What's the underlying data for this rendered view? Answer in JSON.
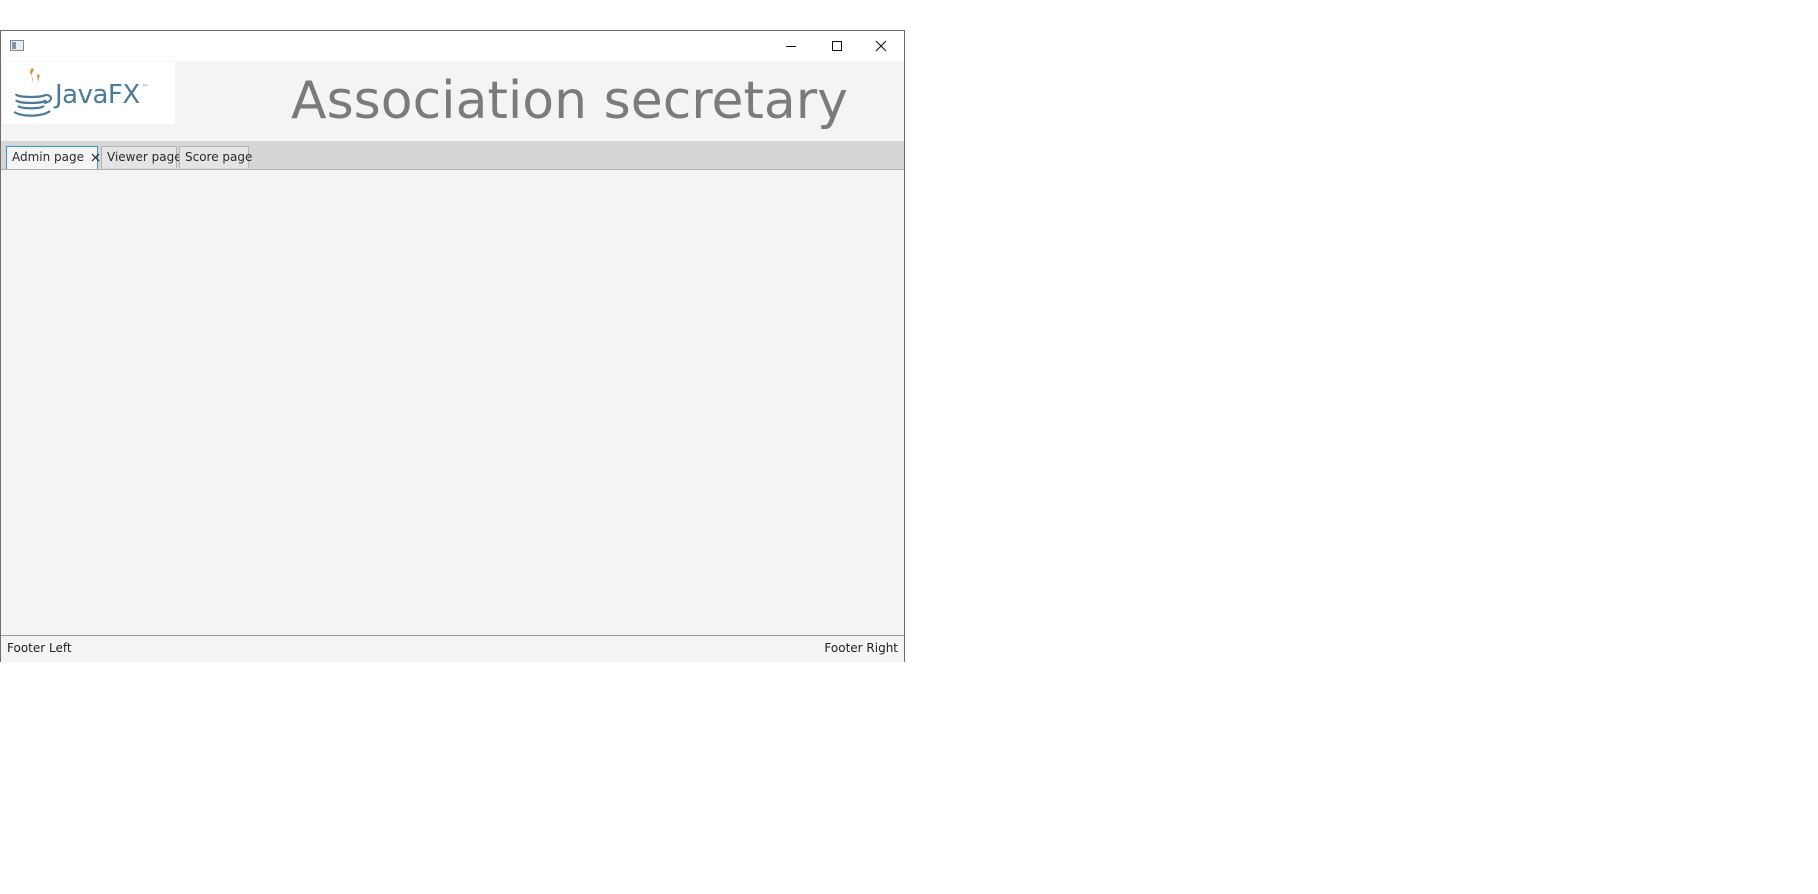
{
  "header": {
    "logo_text": "JavaFX",
    "logo_tm": "™",
    "title": "Association secretary"
  },
  "tabs": [
    {
      "label": "Admin page",
      "active": true,
      "closable": true
    },
    {
      "label": "Viewer page",
      "active": false,
      "closable": false
    },
    {
      "label": "Score page",
      "active": false,
      "closable": false
    }
  ],
  "footer": {
    "left": "Footer Left",
    "right": "Footer Right"
  },
  "colors": {
    "accent": "#3c96d6",
    "title_text": "#7b7b7b",
    "logo_blue": "#4a7a9c",
    "logo_orange": "#e8862a"
  },
  "icons": {
    "app": "app-icon",
    "minimize": "minimize-icon",
    "maximize": "maximize-icon",
    "close": "close-icon",
    "tab_close": "tab-close-icon"
  }
}
